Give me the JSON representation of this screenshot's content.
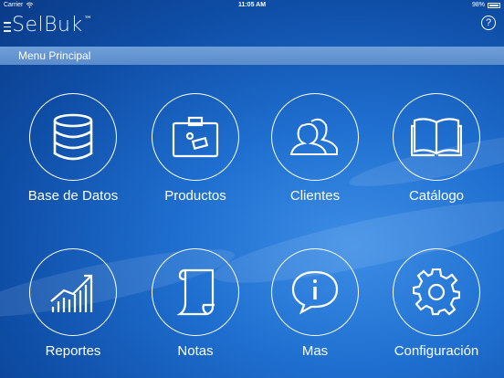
{
  "status_bar": {
    "carrier": "Carrier",
    "time": "11:05 AM",
    "battery": "98%"
  },
  "header": {
    "logo_text": "SelBuk",
    "logo_tm": "™",
    "help_label": "?"
  },
  "menu_bar": {
    "title": "Menu Principal"
  },
  "tiles": [
    {
      "label": "Base de Datos",
      "icon": "database-icon"
    },
    {
      "label": "Productos",
      "icon": "product-box-icon"
    },
    {
      "label": "Clientes",
      "icon": "clients-icon"
    },
    {
      "label": "Catálogo",
      "icon": "catalog-book-icon"
    },
    {
      "label": "Reportes",
      "icon": "reports-chart-icon"
    },
    {
      "label": "Notas",
      "icon": "notes-scroll-icon"
    },
    {
      "label": "Mas",
      "icon": "info-bubble-icon"
    },
    {
      "label": "Configuración",
      "icon": "gear-icon"
    }
  ],
  "colors": {
    "background": "#1f6fd0",
    "menu_bar": "#6f9fd8",
    "foreground": "#ffffff"
  }
}
